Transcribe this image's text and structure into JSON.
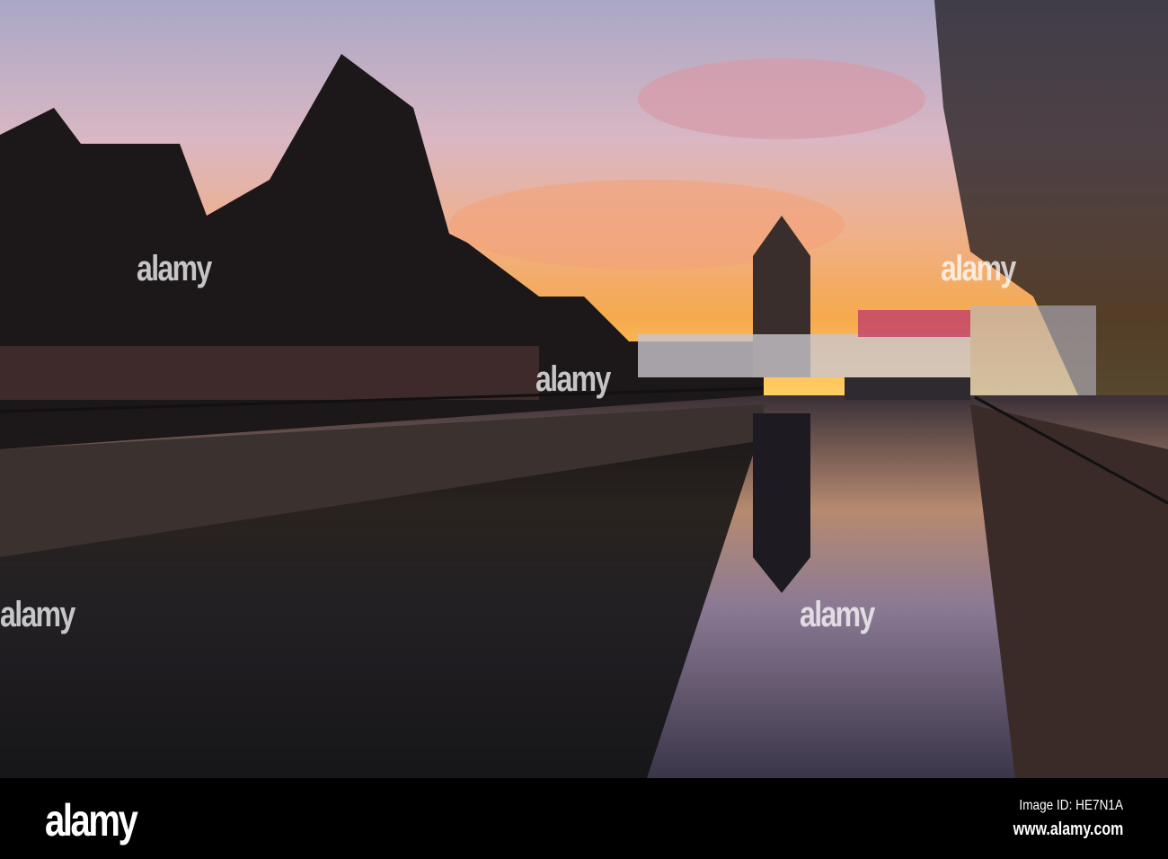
{
  "watermark": {
    "text": "alamy",
    "small_text": "a"
  },
  "footer": {
    "logo": "alamy",
    "image_id": "Image ID: HE7N1A",
    "website": "www.alamy.com"
  },
  "colors": {
    "sky_top": "#b7b3cf",
    "sky_glow": "#f6a94d",
    "water": "#2a2530",
    "footer": "#000000"
  }
}
